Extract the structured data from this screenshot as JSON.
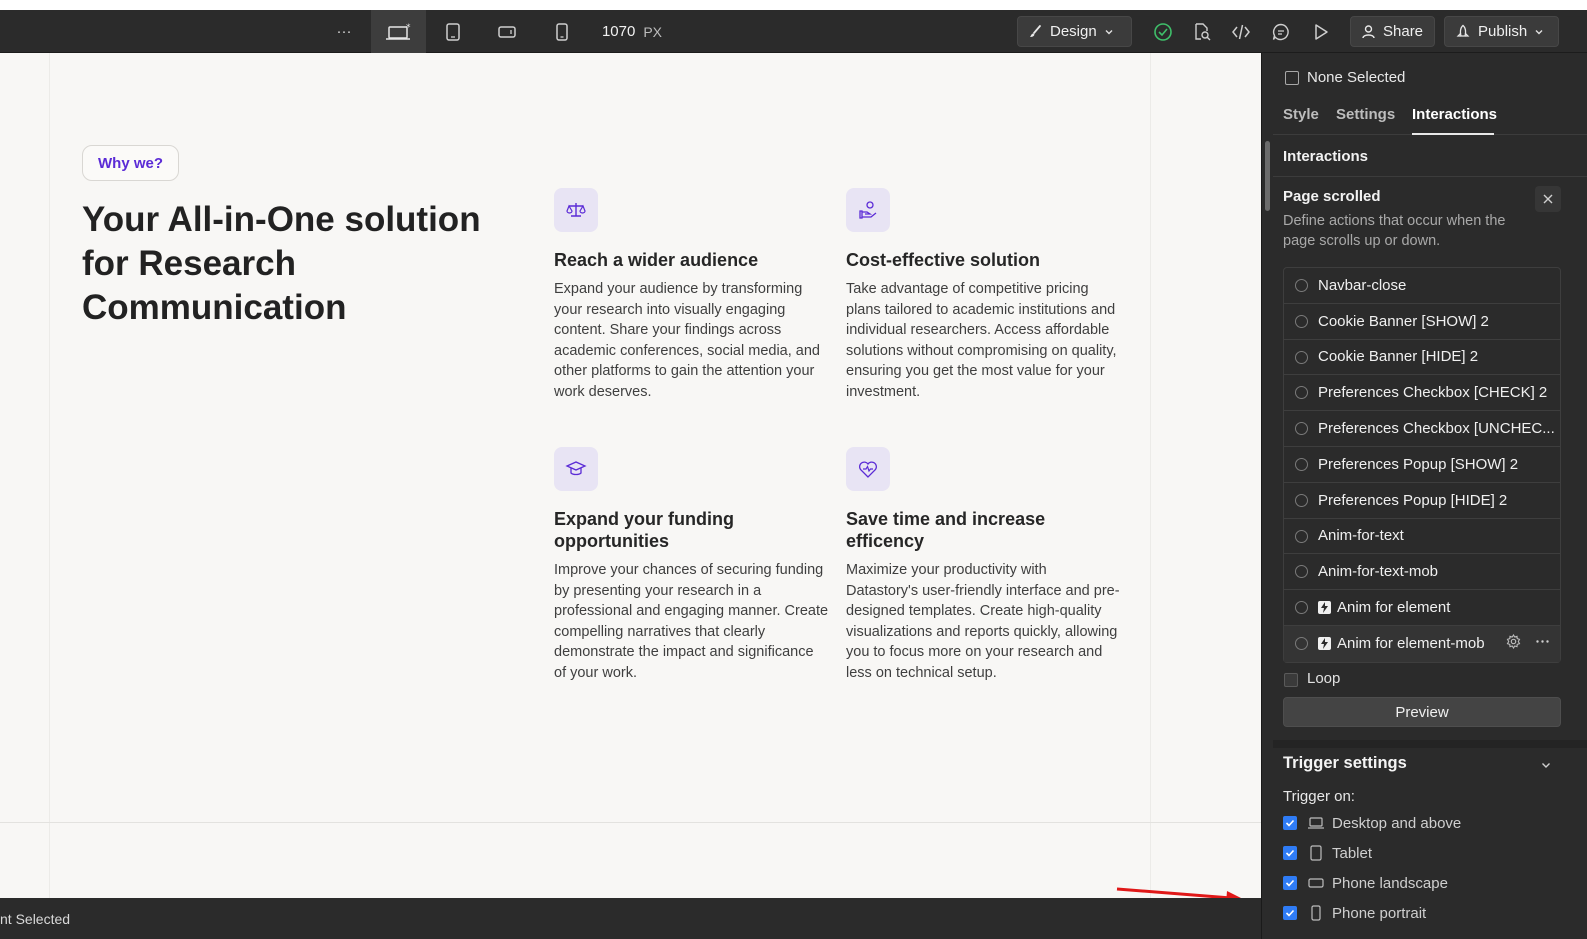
{
  "toolbar": {
    "more_label": "···",
    "width_value": "1070",
    "width_unit": "PX",
    "design_label": "Design",
    "share_label": "Share",
    "publish_label": "Publish"
  },
  "canvas": {
    "pill_label": "Why we?",
    "hero_title": "Your All-in-One solution for Research Communication",
    "features": [
      {
        "title": "Reach a wider audience",
        "body": "Expand your audience by transforming your research into visually engaging content. Share your findings across academic conferences, social media, and other platforms to gain the attention your work deserves."
      },
      {
        "title": "Cost-effective solution",
        "body": "Take advantage of competitive pricing plans tailored to academic institutions and individual researchers. Access affordable solutions without compromising on quality, ensuring you get the most value for your investment."
      },
      {
        "title": "Expand your funding opportunities",
        "body": "Improve your chances of securing funding by presenting your research in a professional and engaging manner. Create compelling narratives that clearly demonstrate the impact and significance of your work."
      },
      {
        "title": "Save time and increase efficency",
        "body": "Maximize your productivity with Datastory's user-friendly interface and pre-designed templates. Create high-quality visualizations and reports quickly, allowing you to focus more on your research and less on technical setup."
      }
    ]
  },
  "statusbar": {
    "text": "nt Selected"
  },
  "panel": {
    "none_selected": "None Selected",
    "tabs": {
      "style": "Style",
      "settings": "Settings",
      "interactions": "Interactions"
    },
    "interactions_heading": "Interactions",
    "page_scrolled_title": "Page scrolled",
    "page_scrolled_desc": "Define actions that occur when the page scrolls up or down.",
    "items": [
      "Navbar-close",
      "Cookie Banner [SHOW] 2",
      "Cookie Banner [HIDE] 2",
      "Preferences Checkbox [CHECK] 2",
      "Preferences Checkbox [UNCHEC...",
      "Preferences Popup [SHOW] 2",
      "Preferences Popup [HIDE] 2",
      "Anim-for-text",
      "Anim-for-text-mob",
      "Anim for element",
      "Anim for element-mob"
    ],
    "loop_label": "Loop",
    "preview_label": "Preview",
    "trigger_settings_title": "Trigger settings",
    "trigger_on_label": "Trigger on:",
    "triggers": {
      "desktop": "Desktop and above",
      "tablet": "Tablet",
      "landscape": "Phone landscape",
      "portrait": "Phone portrait"
    }
  },
  "colors": {
    "accent_purple": "#5b2bd6",
    "checkbox_blue": "#2f7cf6",
    "arrow_red": "#e01818"
  }
}
